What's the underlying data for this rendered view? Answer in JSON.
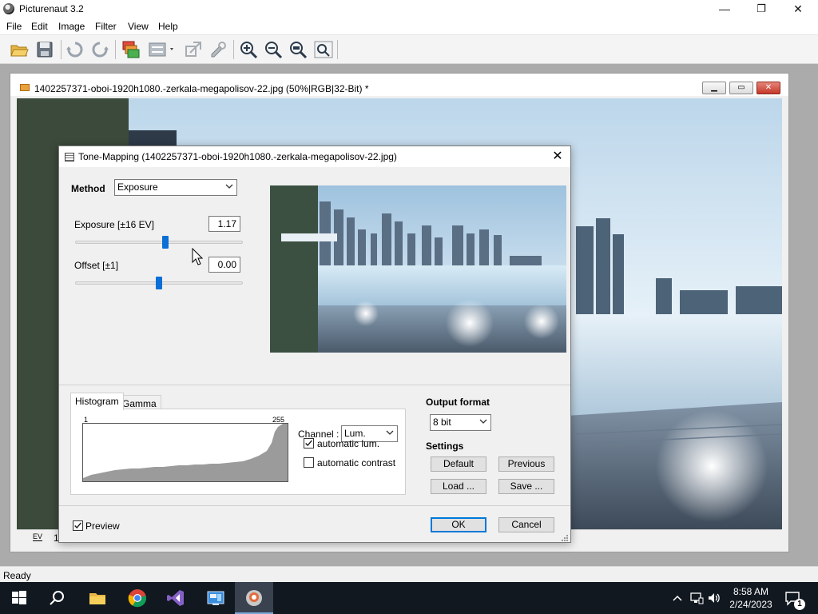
{
  "app": {
    "title": "Picturenaut 3.2",
    "window_controls": {
      "minimize": "—",
      "maximize": "❐",
      "close": "✕"
    }
  },
  "menu": [
    "File",
    "Edit",
    "Image",
    "Filter",
    "View",
    "Help"
  ],
  "toolbar": {
    "icons": [
      "open-icon",
      "save-icon",
      "undo-icon",
      "redo-icon",
      "layers-icon",
      "adjust-icon",
      "transform-icon",
      "tools-icon",
      "zoom-in-icon",
      "zoom-out-icon",
      "zoom-fit-icon",
      "zoom-actual-icon"
    ]
  },
  "child_window": {
    "title": "1402257371-oboi-1920h1080.-zerkala-megapolisov-22.jpg (50%|RGB|32-Bit) *",
    "status_fields": [
      "EV",
      "1"
    ]
  },
  "dialog": {
    "title": "Tone-Mapping (1402257371-oboi-1920h1080.-zerkala-megapolisov-22.jpg)",
    "close": "✕",
    "method_label": "Method",
    "method_value": "Exposure",
    "exposure": {
      "label": "Exposure [±16 EV]",
      "value": "1.17",
      "slider_fraction": 0.54
    },
    "offset": {
      "label": "Offset [±1]",
      "value": "0.00",
      "slider_fraction": 0.5
    },
    "tabs": [
      "Histogram",
      "Gamma"
    ],
    "active_tab": "Histogram",
    "histogram": {
      "min_label": "1",
      "max_label": "255"
    },
    "channel_label": "Channel :",
    "channel_value": "Lum.",
    "automatic_lum": {
      "label": "automatic lum.",
      "checked": true
    },
    "automatic_contrast": {
      "label": "automatic contrast",
      "checked": false
    },
    "output_format_label": "Output format",
    "output_format_value": "8 bit",
    "settings_label": "Settings",
    "buttons": {
      "default": "Default",
      "previous": "Previous",
      "load": "Load ...",
      "save": "Save ..."
    },
    "preview": {
      "label": "Preview",
      "checked": true
    },
    "ok": "OK",
    "cancel": "Cancel"
  },
  "status": {
    "text": "Ready"
  },
  "taskbar": {
    "apps": [
      "windows-start-icon",
      "search-icon",
      "file-explorer-icon",
      "chrome-icon",
      "visual-studio-icon",
      "control-panel-icon",
      "picturenaut-icon"
    ],
    "active_app": "picturenaut-icon",
    "time": "8:58 AM",
    "date": "2/24/2023",
    "notification_count": "1"
  },
  "colors": {
    "slider_thumb": "#0a6fd6",
    "taskbar": "#111820",
    "mdi_background": "#ababab"
  }
}
